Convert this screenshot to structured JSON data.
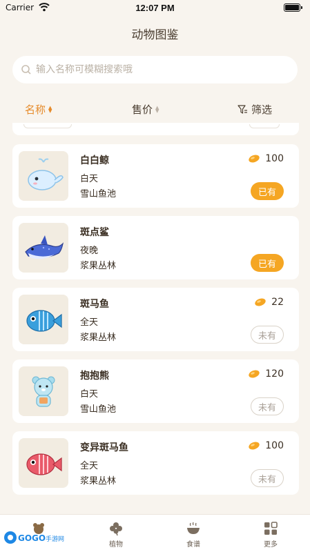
{
  "status_bar": {
    "carrier": "Carrier",
    "time": "12:07 PM"
  },
  "header": {
    "title": "动物图鉴"
  },
  "search": {
    "placeholder": "输入名称可模糊搜索哦"
  },
  "sort_bar": {
    "name_label": "名称",
    "price_label": "售价",
    "filter_label": "筛选"
  },
  "animals": [
    {
      "name": "白白鲸",
      "time": "白天",
      "location": "雪山鱼池",
      "price": "100",
      "status": "已有",
      "owned": true,
      "price_visible": true,
      "color": "#cfe6f8"
    },
    {
      "name": "斑点鲨",
      "time": "夜晚",
      "location": "浆果丛林",
      "price": "",
      "status": "已有",
      "owned": true,
      "price_visible": false,
      "color": "#4b6ad6"
    },
    {
      "name": "斑马鱼",
      "time": "全天",
      "location": "浆果丛林",
      "price": "22",
      "status": "未有",
      "owned": false,
      "price_visible": true,
      "color": "#3a9fdc"
    },
    {
      "name": "抱抱熊",
      "time": "白天",
      "location": "雪山鱼池",
      "price": "120",
      "status": "未有",
      "owned": false,
      "price_visible": true,
      "color": "#a8dced"
    },
    {
      "name": "变异斑马鱼",
      "time": "全天",
      "location": "浆果丛林",
      "price": "100",
      "status": "未有",
      "owned": false,
      "price_visible": true,
      "color": "#e95b6a"
    }
  ],
  "tab_bar": [
    {
      "label": "",
      "icon": "animal-icon",
      "active": true
    },
    {
      "label": "植物",
      "icon": "clover-icon",
      "active": false
    },
    {
      "label": "食谱",
      "icon": "bowl-icon",
      "active": false
    },
    {
      "label": "更多",
      "icon": "grid-icon",
      "active": false
    }
  ],
  "watermark": {
    "text": "GOGO手游网"
  },
  "colors": {
    "accent": "#e68b2b",
    "badge_owned": "#f5a623",
    "background": "#f8f4ee"
  }
}
